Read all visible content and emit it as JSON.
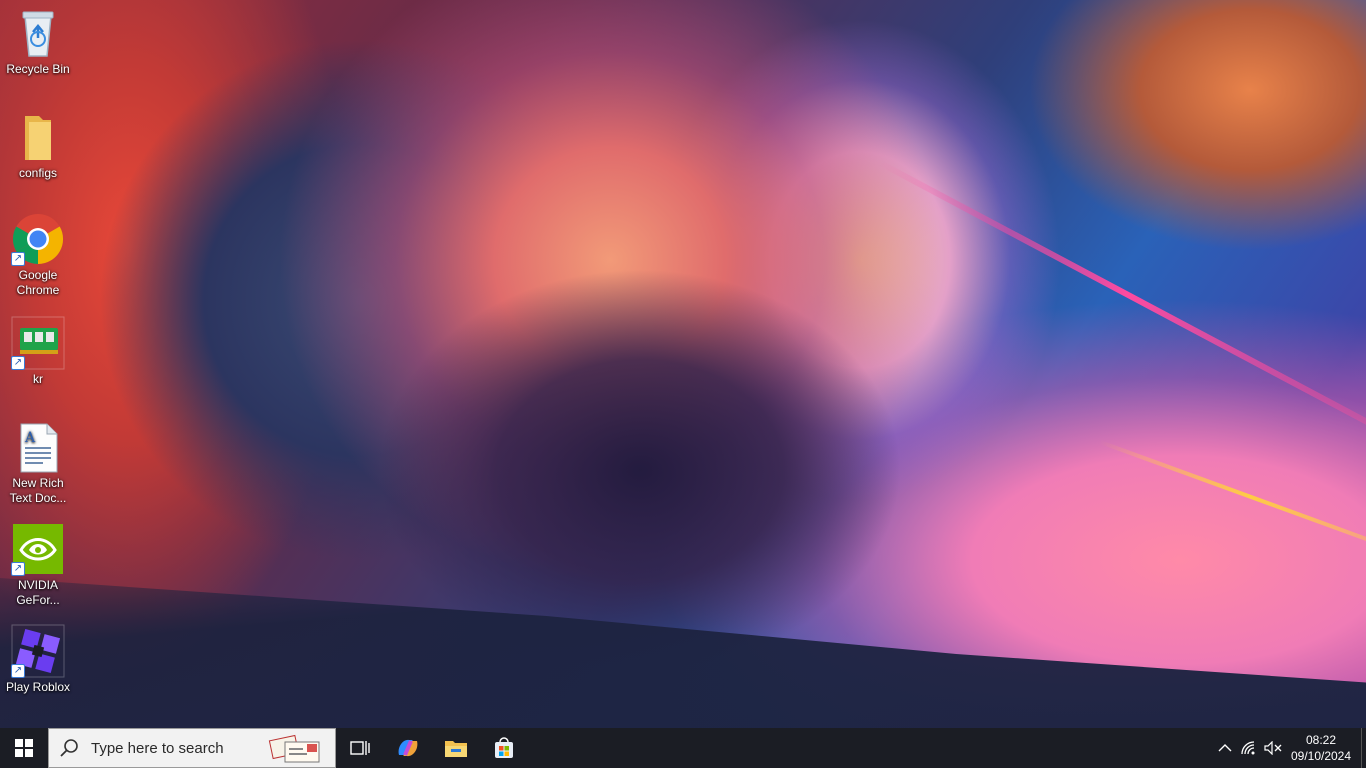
{
  "desktop": {
    "icons": [
      {
        "label": "Recycle Bin",
        "icon": "recycle-bin-icon"
      },
      {
        "label": "configs",
        "icon": "folder-icon"
      },
      {
        "label": "Google Chrome",
        "icon": "chrome-icon"
      },
      {
        "label": "kr",
        "icon": "ram-chip-icon"
      },
      {
        "label": "New Rich Text Doc...",
        "icon": "document-icon"
      },
      {
        "label": "NVIDIA GeFor...",
        "icon": "nvidia-icon"
      },
      {
        "label": "Play Roblox",
        "icon": "roblox-icon"
      }
    ]
  },
  "taskbar": {
    "search_placeholder": "Type here to search",
    "pinned": [
      "task-view-icon",
      "copilot-icon",
      "file-explorer-icon",
      "microsoft-store-icon"
    ],
    "tray": {
      "icons": [
        "show-hidden-icons-chevron",
        "network-icon",
        "volume-muted-icon"
      ],
      "time": "08:22",
      "date": "09/10/2024"
    }
  },
  "colors": {
    "taskbar_bg": "#1b1d24",
    "search_bg": "#f2f2f2",
    "windows_blue": "#0078d4",
    "nvidia_green": "#76b900",
    "roblox_purple": "#6a3df0"
  }
}
